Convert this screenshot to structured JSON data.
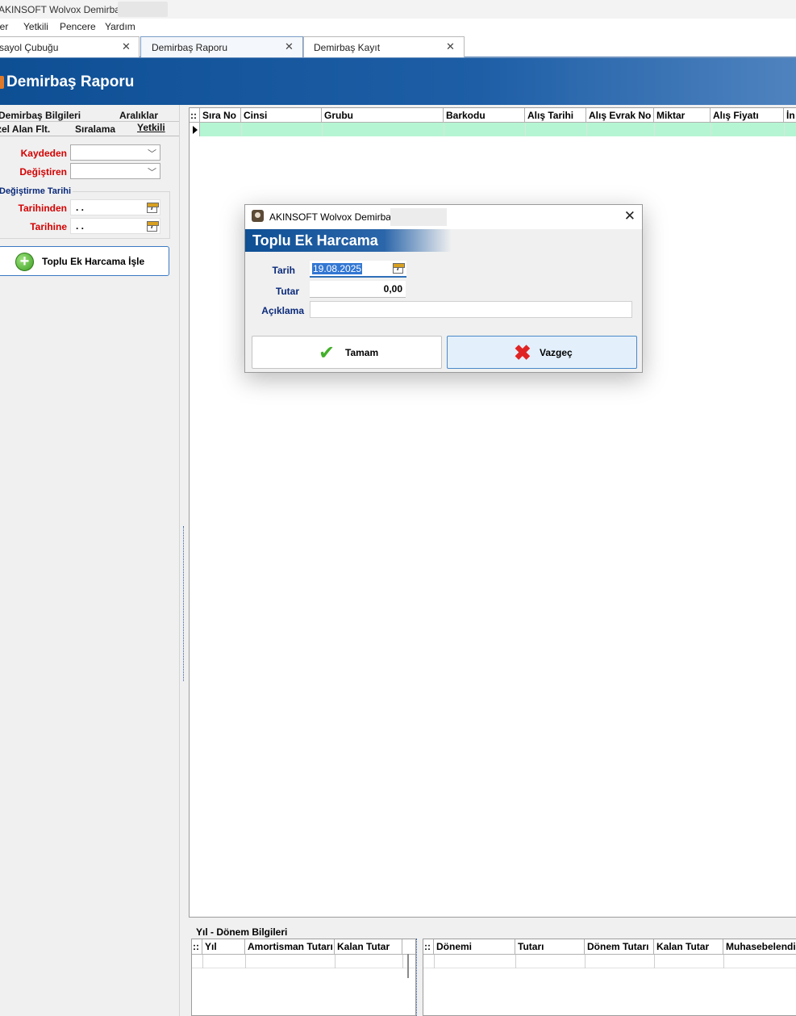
{
  "window": {
    "title": "AKINSOFT Wolvox Demirbaş"
  },
  "menu": [
    "ler",
    "Yetkili",
    "Pencere",
    "Yardım"
  ],
  "tabs": [
    {
      "label": "sayol Çubuğu"
    },
    {
      "label": "Demirbaş Raporu"
    },
    {
      "label": "Demirbaş Kayıt"
    }
  ],
  "header": {
    "title": "Demirbaş Raporu"
  },
  "left_panel": {
    "tabs_row1": [
      "Demirbaş Bilgileri",
      "Aralıklar"
    ],
    "tabs_row2": [
      "zel Alan Flt.",
      "Sıralama",
      "Yetkili"
    ],
    "fields": {
      "kaydeden_label": "Kaydeden",
      "degistiren_label": "Değiştiren",
      "kaydeden_value": "",
      "degistiren_value": ""
    },
    "date_group": {
      "title": "Değiştirme Tarihi",
      "from_label": "Tarihinden",
      "to_label": "Tarihine",
      "from_value": ". .",
      "to_value": ". ."
    },
    "action_button": "Toplu Ek Harcama İşle"
  },
  "main_grid": {
    "columns": [
      "::",
      "Sıra No",
      "Cinsi",
      "Grubu",
      "Barkodu",
      "Alış Tarihi",
      "Alış Evrak No",
      "Miktar",
      "Alış Fiyatı",
      "İn"
    ]
  },
  "bottom": {
    "title": "Yıl - Dönem Bilgileri",
    "left_columns": [
      "::",
      "Yıl",
      "Amortisman Tutarı",
      "Kalan Tutar"
    ],
    "right_columns": [
      "::",
      "Dönemi",
      "Tutarı",
      "Dönem Tutarı",
      "Kalan Tutar",
      "Muhasebelendi"
    ]
  },
  "dialog": {
    "window_title": "AKINSOFT Wolvox Demirbaş",
    "title": "Toplu Ek Harcama",
    "tarih_label": "Tarih",
    "tarih_value": "19.08.2025",
    "tutar_label": "Tutar",
    "tutar_value": "0,00",
    "aciklama_label": "Açıklama",
    "aciklama_value": "",
    "ok_button": "Tamam",
    "cancel_button": "Vazgeç"
  },
  "icons": {
    "calendar": "calendar-icon",
    "close": "close-icon",
    "add": "plus-circle-icon",
    "ok": "checkmark-icon",
    "cancel": "x-mark-icon"
  },
  "colors": {
    "header_blue": "#0e4f94",
    "label_red": "#d40000",
    "label_navy": "#0a2a7a",
    "grid_row_green": "#b6f5d3",
    "selection_blue": "#3277d3"
  }
}
